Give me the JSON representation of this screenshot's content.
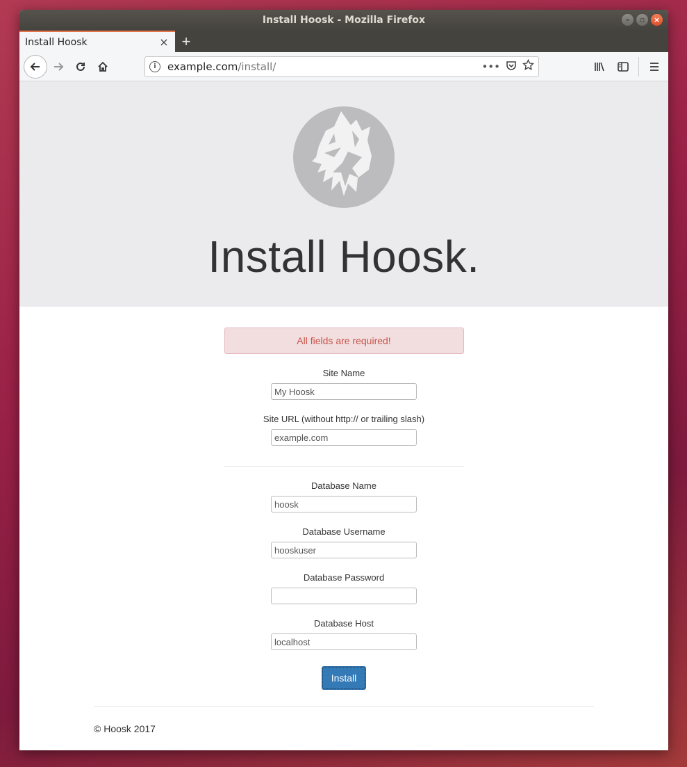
{
  "window": {
    "title": "Install Hoosk - Mozilla Firefox"
  },
  "tab": {
    "label": "Install Hoosk",
    "close": "×",
    "new_tab": "+"
  },
  "nav": {
    "host": "example.com",
    "path": "/install/",
    "page_actions": "•••"
  },
  "hero": {
    "heading": "Install Hoosk."
  },
  "alert": {
    "message": "All fields are required!"
  },
  "form": {
    "site_name": {
      "label": "Site Name",
      "placeholder": "My Hoosk"
    },
    "site_url": {
      "label": "Site URL (without http:// or trailing slash)",
      "placeholder": "example.com"
    },
    "db_name": {
      "label": "Database Name",
      "placeholder": "hoosk"
    },
    "db_user": {
      "label": "Database Username",
      "placeholder": "hooskuser"
    },
    "db_pass": {
      "label": "Database Password",
      "placeholder": ""
    },
    "db_host": {
      "label": "Database Host",
      "placeholder": "localhost"
    },
    "submit": "Install"
  },
  "footer": {
    "text": "© Hoosk 2017"
  },
  "colors": {
    "accent": "#337ab7",
    "alert_text": "#c7554d",
    "alert_bg": "#f2dede",
    "hero_bg": "#ebebed"
  }
}
